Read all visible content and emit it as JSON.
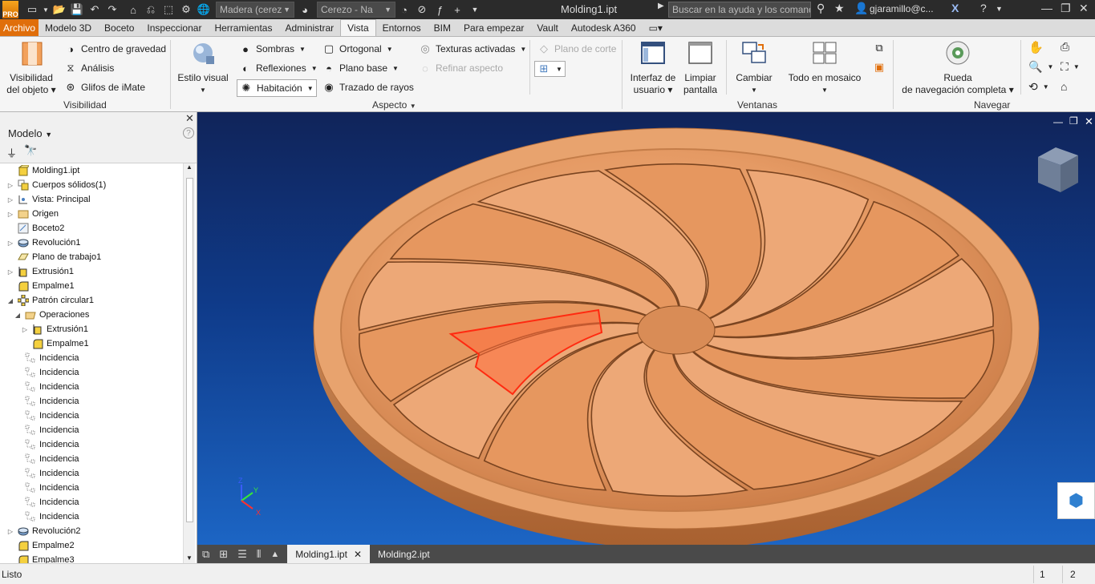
{
  "titlebar": {
    "material": "Madera (cereza)",
    "appearance": "Cerezo - Na",
    "document_title": "Molding1.ipt",
    "search_placeholder": "Buscar en la ayuda y los comandos",
    "user": "gjaramillo@c..."
  },
  "tabs": [
    "Archivo",
    "Modelo 3D",
    "Boceto",
    "Inspeccionar",
    "Herramientas",
    "Administrar",
    "Vista",
    "Entornos",
    "BIM",
    "Para empezar",
    "Vault",
    "Autodesk A360"
  ],
  "active_tab": "Vista",
  "ribbon": {
    "visibility": {
      "object_visibility": [
        "Visibilidad",
        "del objeto"
      ],
      "center_of_gravity": "Centro de gravedad",
      "analysis": "Análisis",
      "imate_glyphs": "Glifos de iMate",
      "group": "Visibilidad"
    },
    "appearance": {
      "visual_style": "Estilo visual",
      "shadows": "Sombras",
      "reflections": "Reflexiones",
      "room": "Habitación",
      "orthographic": "Ortogonal",
      "ground_plane": "Plano base",
      "ray_tracing": "Trazado de rayos",
      "textures_on": "Texturas activadas",
      "refine_appearance": "Refinar aspecto",
      "section_plane": "Plano de corte",
      "group": "Aspecto"
    },
    "windows": {
      "user_interface": [
        "Interfaz de",
        "usuario"
      ],
      "clean_screen": [
        "Limpiar",
        "pantalla"
      ],
      "switch": "Cambiar",
      "tile_all": "Todo en mosaico",
      "group": "Ventanas"
    },
    "navigate": {
      "full_nav_wheel": [
        "Rueda",
        "de navegación completa"
      ],
      "group": "Navegar"
    }
  },
  "browser": {
    "title": "Modelo",
    "tree": [
      {
        "label": "Molding1.ipt",
        "level": 0,
        "expander": "",
        "icon": "part-icon"
      },
      {
        "label": "Cuerpos sólidos(1)",
        "level": 0,
        "expander": "▷",
        "icon": "solid-bodies-icon"
      },
      {
        "label": "Vista: Principal",
        "level": 0,
        "expander": "▷",
        "icon": "view-rep-icon"
      },
      {
        "label": "Origen",
        "level": 0,
        "expander": "▷",
        "icon": "folder-icon"
      },
      {
        "label": "Boceto2",
        "level": 0,
        "expander": "",
        "icon": "sketch-icon"
      },
      {
        "label": "Revolución1",
        "level": 0,
        "expander": "▷",
        "icon": "revolve-icon"
      },
      {
        "label": "Plano de trabajo1",
        "level": 0,
        "expander": "",
        "icon": "work-plane-icon"
      },
      {
        "label": "Extrusión1",
        "level": 0,
        "expander": "▷",
        "icon": "extrude-icon"
      },
      {
        "label": "Empalme1",
        "level": 0,
        "expander": "",
        "icon": "fillet-icon"
      },
      {
        "label": "Patrón circular1",
        "level": 0,
        "expander": "◢",
        "icon": "circular-pattern-icon"
      },
      {
        "label": "Operaciones",
        "level": 1,
        "expander": "◢",
        "icon": "folder-open-icon"
      },
      {
        "label": "Extrusión1",
        "level": 2,
        "expander": "▷",
        "icon": "extrude-icon"
      },
      {
        "label": "Empalme1",
        "level": 2,
        "expander": "",
        "icon": "fillet-icon"
      },
      {
        "label": "Incidencia",
        "level": 1,
        "expander": "",
        "icon": "occurrence-icon"
      },
      {
        "label": "Incidencia",
        "level": 1,
        "expander": "",
        "icon": "occurrence-icon"
      },
      {
        "label": "Incidencia",
        "level": 1,
        "expander": "",
        "icon": "occurrence-icon"
      },
      {
        "label": "Incidencia",
        "level": 1,
        "expander": "",
        "icon": "occurrence-icon"
      },
      {
        "label": "Incidencia",
        "level": 1,
        "expander": "",
        "icon": "occurrence-icon"
      },
      {
        "label": "Incidencia",
        "level": 1,
        "expander": "",
        "icon": "occurrence-icon"
      },
      {
        "label": "Incidencia",
        "level": 1,
        "expander": "",
        "icon": "occurrence-icon"
      },
      {
        "label": "Incidencia",
        "level": 1,
        "expander": "",
        "icon": "occurrence-icon"
      },
      {
        "label": "Incidencia",
        "level": 1,
        "expander": "",
        "icon": "occurrence-icon"
      },
      {
        "label": "Incidencia",
        "level": 1,
        "expander": "",
        "icon": "occurrence-icon"
      },
      {
        "label": "Incidencia",
        "level": 1,
        "expander": "",
        "icon": "occurrence-icon"
      },
      {
        "label": "Incidencia",
        "level": 1,
        "expander": "",
        "icon": "occurrence-icon"
      },
      {
        "label": "Revolución2",
        "level": 0,
        "expander": "▷",
        "icon": "revolve-icon"
      },
      {
        "label": "Empalme2",
        "level": 0,
        "expander": "",
        "icon": "fillet-icon"
      },
      {
        "label": "Empalme3",
        "level": 0,
        "expander": "",
        "icon": "fillet-icon"
      }
    ]
  },
  "documents": {
    "tabs": [
      {
        "label": "Molding1.ipt",
        "active": true
      },
      {
        "label": "Molding2.ipt",
        "active": false
      }
    ]
  },
  "status": {
    "text": "Listo",
    "count_a": "1",
    "count_b": "2"
  },
  "colors": {
    "accent": "#e06e0a",
    "selection": "#ff2a10",
    "wood": "#e59a64"
  }
}
